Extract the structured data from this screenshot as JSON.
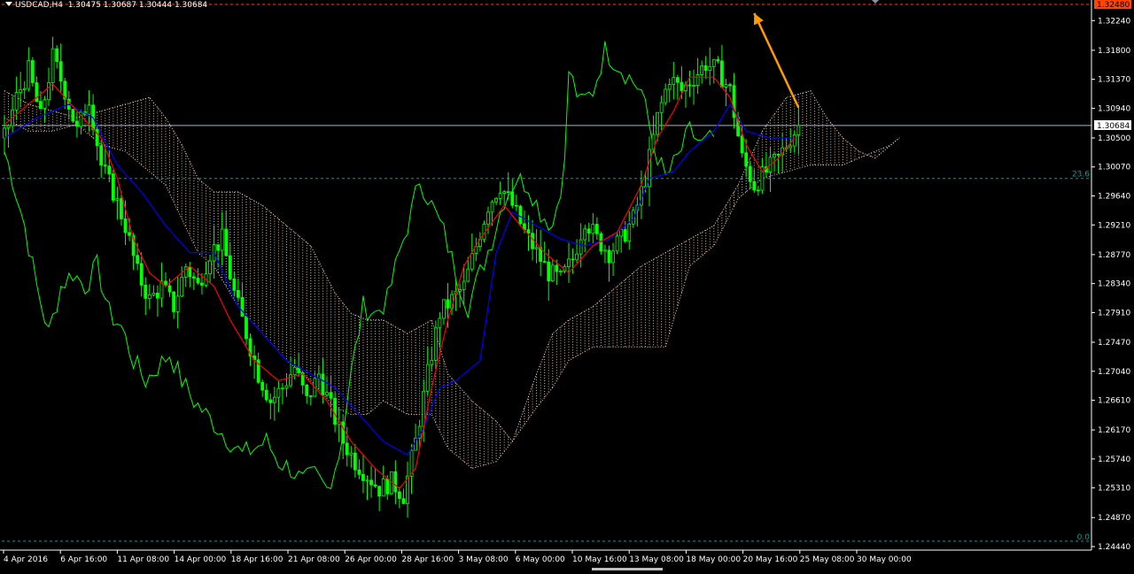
{
  "header": {
    "symbol_label": "USDCAD,H4",
    "ohlc": "1.30475 1.30687 1.30444 1.30684"
  },
  "colors": {
    "background": "#000000",
    "axis": "#ffffff",
    "candles": "#00ff00",
    "tenkan": "#ff0000",
    "kijun": "#0000ff",
    "chikou": "#00ff00",
    "cloud": "#ffdab9",
    "price_line": "#a9b5c9",
    "fib_line": "#00a0a0",
    "top_level_line": "#ff4500",
    "arrow": "#ff9a00"
  },
  "chart_data": {
    "type": "candlestick",
    "timeframe": "H4",
    "ylim": [
      1.2444,
      1.3248
    ],
    "y_tick_labels": [
      "1.32240",
      "1.31800",
      "1.31370",
      "1.30940",
      "1.30500",
      "1.30070",
      "1.29640",
      "1.29210",
      "1.28770",
      "1.28340",
      "1.27910",
      "1.27470",
      "1.27040",
      "1.26610",
      "1.26170",
      "1.25740",
      "1.25310",
      "1.24870",
      "1.24440"
    ],
    "y_ticks": [
      1.3224,
      1.318,
      1.3137,
      1.3094,
      1.305,
      1.3007,
      1.2964,
      1.2921,
      1.2877,
      1.2834,
      1.2791,
      1.2747,
      1.2704,
      1.2661,
      1.2617,
      1.2574,
      1.2531,
      1.2487,
      1.2444
    ],
    "x_tick_labels": [
      "4 Apr 2016",
      "6 Apr 16:00",
      "11 Apr 08:00",
      "14 Apr 00:00",
      "18 Apr 16:00",
      "21 Apr 08:00",
      "26 Apr 00:00",
      "28 Apr 16:00",
      "3 May 08:00",
      "6 May 00:00",
      "10 May 16:00",
      "13 May 08:00",
      "18 May 00:00",
      "20 May 16:00",
      "25 May 08:00",
      "30 May 00:00"
    ],
    "current_price": {
      "value": 1.30684,
      "label": "1.30684"
    },
    "top_level": {
      "value": 1.3248,
      "label": "1.32480"
    },
    "fibonacci": [
      {
        "label": "23.6",
        "value": 1.299
      },
      {
        "label": "0.0",
        "value": 1.2452
      }
    ],
    "close_path": [
      [
        0,
        1.305
      ],
      [
        3,
        1.311
      ],
      [
        6,
        1.315
      ],
      [
        9,
        1.308
      ],
      [
        12,
        1.317
      ],
      [
        15,
        1.312
      ],
      [
        18,
        1.306
      ],
      [
        21,
        1.311
      ],
      [
        24,
        1.301
      ],
      [
        27,
        1.297
      ],
      [
        30,
        1.292
      ],
      [
        33,
        1.285
      ],
      [
        36,
        1.281
      ],
      [
        39,
        1.283
      ],
      [
        42,
        1.28
      ],
      [
        45,
        1.286
      ],
      [
        48,
        1.283
      ],
      [
        51,
        1.288
      ],
      [
        54,
        1.29
      ],
      [
        57,
        1.282
      ],
      [
        60,
        1.276
      ],
      [
        63,
        1.27
      ],
      [
        66,
        1.266
      ],
      [
        69,
        1.268
      ],
      [
        72,
        1.271
      ],
      [
        75,
        1.266
      ],
      [
        78,
        1.27
      ],
      [
        81,
        1.265
      ],
      [
        84,
        1.26
      ],
      [
        87,
        1.257
      ],
      [
        90,
        1.255
      ],
      [
        93,
        1.253
      ],
      [
        96,
        1.254
      ],
      [
        99,
        1.252
      ],
      [
        102,
        1.26
      ],
      [
        105,
        1.27
      ],
      [
        108,
        1.279
      ],
      [
        111,
        1.281
      ],
      [
        114,
        1.283
      ],
      [
        117,
        1.289
      ],
      [
        120,
        1.295
      ],
      [
        123,
        1.298
      ],
      [
        126,
        1.295
      ],
      [
        129,
        1.291
      ],
      [
        132,
        1.288
      ],
      [
        135,
        1.285
      ],
      [
        138,
        1.284
      ],
      [
        141,
        1.287
      ],
      [
        144,
        1.293
      ],
      [
        147,
        1.29
      ],
      [
        150,
        1.288
      ],
      [
        153,
        1.29
      ],
      [
        156,
        1.293
      ],
      [
        159,
        1.299
      ],
      [
        162,
        1.308
      ],
      [
        165,
        1.314
      ],
      [
        168,
        1.312
      ],
      [
        171,
        1.314
      ],
      [
        174,
        1.316
      ],
      [
        177,
        1.315
      ],
      [
        180,
        1.312
      ],
      [
        183,
        1.302
      ],
      [
        186,
        1.298
      ],
      [
        189,
        1.3
      ],
      [
        192,
        1.302
      ],
      [
        195,
        1.305
      ],
      [
        197,
        1.3068
      ]
    ],
    "chikou_path": [
      [
        0,
        1.303
      ],
      [
        2,
        1.299
      ],
      [
        5,
        1.292
      ],
      [
        8,
        1.283
      ],
      [
        11,
        1.276
      ],
      [
        14,
        1.283
      ],
      [
        17,
        1.285
      ],
      [
        20,
        1.283
      ],
      [
        23,
        1.286
      ],
      [
        26,
        1.279
      ],
      [
        29,
        1.277
      ],
      [
        32,
        1.272
      ],
      [
        35,
        1.269
      ],
      [
        38,
        1.271
      ],
      [
        41,
        1.273
      ],
      [
        44,
        1.269
      ],
      [
        47,
        1.266
      ],
      [
        50,
        1.264
      ],
      [
        53,
        1.262
      ],
      [
        56,
        1.26
      ],
      [
        59,
        1.258
      ],
      [
        62,
        1.259
      ],
      [
        65,
        1.26
      ],
      [
        68,
        1.257
      ],
      [
        71,
        1.256
      ],
      [
        74,
        1.254
      ],
      [
        77,
        1.255
      ],
      [
        80,
        1.253
      ],
      [
        83,
        1.258
      ],
      [
        86,
        1.27
      ],
      [
        89,
        1.28
      ],
      [
        92,
        1.279
      ],
      [
        95,
        1.281
      ],
      [
        98,
        1.288
      ],
      [
        101,
        1.294
      ],
      [
        103,
        1.299
      ],
      [
        106,
        1.295
      ],
      [
        109,
        1.291
      ],
      [
        112,
        1.285
      ],
      [
        115,
        1.28
      ],
      [
        118,
        1.285
      ],
      [
        121,
        1.29
      ],
      [
        124,
        1.296
      ],
      [
        127,
        1.299
      ],
      [
        130,
        1.298
      ],
      [
        133,
        1.294
      ],
      [
        136,
        1.292
      ],
      [
        139,
        1.301
      ],
      [
        140,
        1.315
      ],
      [
        143,
        1.31
      ],
      [
        146,
        1.312
      ],
      [
        149,
        1.318
      ],
      [
        152,
        1.316
      ],
      [
        155,
        1.314
      ],
      [
        158,
        1.312
      ],
      [
        161,
        1.304
      ],
      [
        164,
        1.299
      ],
      [
        167,
        1.302
      ],
      [
        170,
        1.306
      ],
      [
        173,
        1.304
      ],
      [
        176,
        1.305
      ]
    ],
    "tenkan_path": [
      [
        0,
        1.307
      ],
      [
        6,
        1.31
      ],
      [
        12,
        1.313
      ],
      [
        18,
        1.309
      ],
      [
        24,
        1.305
      ],
      [
        28,
        1.299
      ],
      [
        32,
        1.29
      ],
      [
        36,
        1.285
      ],
      [
        40,
        1.283
      ],
      [
        46,
        1.286
      ],
      [
        52,
        1.283
      ],
      [
        56,
        1.278
      ],
      [
        62,
        1.272
      ],
      [
        68,
        1.269
      ],
      [
        74,
        1.27
      ],
      [
        80,
        1.266
      ],
      [
        86,
        1.26
      ],
      [
        92,
        1.256
      ],
      [
        98,
        1.253
      ],
      [
        102,
        1.256
      ],
      [
        106,
        1.268
      ],
      [
        110,
        1.278
      ],
      [
        114,
        1.286
      ],
      [
        118,
        1.29
      ],
      [
        124,
        1.295
      ],
      [
        128,
        1.292
      ],
      [
        134,
        1.288
      ],
      [
        140,
        1.285
      ],
      [
        146,
        1.289
      ],
      [
        152,
        1.291
      ],
      [
        158,
        1.298
      ],
      [
        162,
        1.305
      ],
      [
        166,
        1.309
      ],
      [
        170,
        1.314
      ],
      [
        176,
        1.314
      ],
      [
        180,
        1.311
      ],
      [
        184,
        1.304
      ],
      [
        188,
        1.3
      ],
      [
        192,
        1.302
      ],
      [
        196,
        1.305
      ]
    ],
    "kijun_path": [
      [
        0,
        1.305
      ],
      [
        8,
        1.308
      ],
      [
        16,
        1.31
      ],
      [
        22,
        1.308
      ],
      [
        28,
        1.301
      ],
      [
        34,
        1.297
      ],
      [
        40,
        1.292
      ],
      [
        46,
        1.288
      ],
      [
        52,
        1.288
      ],
      [
        58,
        1.28
      ],
      [
        64,
        1.276
      ],
      [
        70,
        1.272
      ],
      [
        76,
        1.27
      ],
      [
        82,
        1.268
      ],
      [
        88,
        1.264
      ],
      [
        94,
        1.26
      ],
      [
        100,
        1.258
      ],
      [
        104,
        1.262
      ],
      [
        108,
        1.268
      ],
      [
        112,
        1.269
      ],
      [
        118,
        1.272
      ],
      [
        122,
        1.288
      ],
      [
        126,
        1.294
      ],
      [
        132,
        1.292
      ],
      [
        138,
        1.29
      ],
      [
        144,
        1.289
      ],
      [
        150,
        1.29
      ],
      [
        156,
        1.293
      ],
      [
        160,
        1.299
      ],
      [
        166,
        1.3
      ],
      [
        170,
        1.303
      ],
      [
        176,
        1.306
      ],
      [
        180,
        1.31
      ],
      [
        184,
        1.306
      ],
      [
        190,
        1.305
      ],
      [
        196,
        1.305
      ]
    ],
    "cloud_a_path": [
      [
        0,
        1.312
      ],
      [
        6,
        1.31
      ],
      [
        12,
        1.309
      ],
      [
        18,
        1.308
      ],
      [
        24,
        1.309
      ],
      [
        30,
        1.31
      ],
      [
        36,
        1.311
      ],
      [
        40,
        1.308
      ],
      [
        44,
        1.304
      ],
      [
        48,
        1.299
      ],
      [
        52,
        1.297
      ],
      [
        58,
        1.297
      ],
      [
        64,
        1.295
      ],
      [
        70,
        1.292
      ],
      [
        76,
        1.289
      ],
      [
        82,
        1.282
      ],
      [
        86,
        1.279
      ],
      [
        90,
        1.278
      ],
      [
        94,
        1.278
      ],
      [
        100,
        1.276
      ],
      [
        106,
        1.278
      ],
      [
        110,
        1.27
      ],
      [
        116,
        1.266
      ],
      [
        122,
        1.263
      ],
      [
        126,
        1.26
      ],
      [
        132,
        1.27
      ],
      [
        136,
        1.276
      ],
      [
        140,
        1.278
      ],
      [
        146,
        1.28
      ],
      [
        152,
        1.283
      ],
      [
        158,
        1.286
      ],
      [
        164,
        1.288
      ],
      [
        170,
        1.29
      ],
      [
        176,
        1.292
      ],
      [
        182,
        1.298
      ],
      [
        188,
        1.306
      ],
      [
        194,
        1.311
      ],
      [
        200,
        1.312
      ],
      [
        204,
        1.308
      ],
      [
        208,
        1.305
      ],
      [
        212,
        1.303
      ],
      [
        216,
        1.302
      ],
      [
        220,
        1.304
      ],
      [
        222,
        1.305
      ]
    ],
    "cloud_b_path": [
      [
        0,
        1.308
      ],
      [
        6,
        1.306
      ],
      [
        12,
        1.306
      ],
      [
        18,
        1.307
      ],
      [
        24,
        1.304
      ],
      [
        30,
        1.303
      ],
      [
        36,
        1.3
      ],
      [
        40,
        1.298
      ],
      [
        44,
        1.293
      ],
      [
        48,
        1.288
      ],
      [
        52,
        1.286
      ],
      [
        58,
        1.28
      ],
      [
        64,
        1.276
      ],
      [
        70,
        1.272
      ],
      [
        76,
        1.269
      ],
      [
        82,
        1.265
      ],
      [
        86,
        1.264
      ],
      [
        90,
        1.264
      ],
      [
        94,
        1.266
      ],
      [
        100,
        1.264
      ],
      [
        106,
        1.264
      ],
      [
        110,
        1.259
      ],
      [
        116,
        1.256
      ],
      [
        122,
        1.257
      ],
      [
        126,
        1.26
      ],
      [
        132,
        1.265
      ],
      [
        136,
        1.268
      ],
      [
        140,
        1.272
      ],
      [
        146,
        1.274
      ],
      [
        152,
        1.274
      ],
      [
        158,
        1.274
      ],
      [
        164,
        1.274
      ],
      [
        170,
        1.286
      ],
      [
        176,
        1.289
      ],
      [
        182,
        1.296
      ],
      [
        188,
        1.299
      ],
      [
        194,
        1.3
      ],
      [
        200,
        1.301
      ],
      [
        204,
        1.301
      ],
      [
        208,
        1.301
      ],
      [
        212,
        1.302
      ],
      [
        216,
        1.303
      ],
      [
        220,
        1.304
      ],
      [
        222,
        1.305
      ]
    ],
    "annotation_arrow": {
      "from": [
        197,
        1.3095
      ],
      "to": [
        186,
        1.3235
      ]
    }
  }
}
